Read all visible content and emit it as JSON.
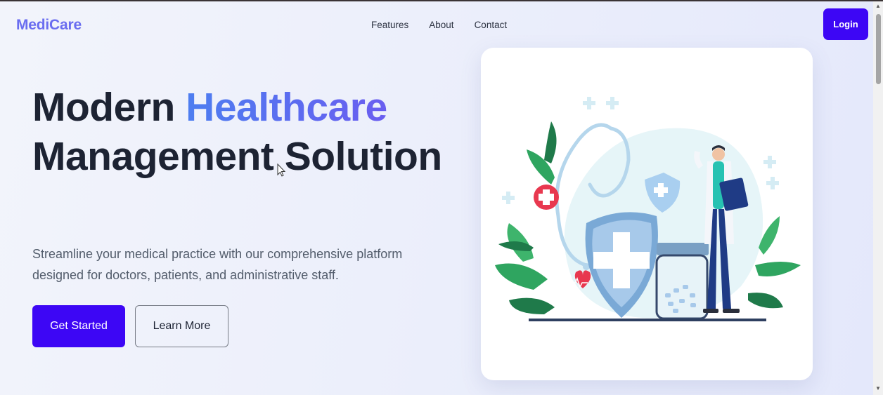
{
  "header": {
    "logo": "MediCare",
    "nav_links": [
      "Features",
      "About",
      "Contact"
    ],
    "login_label": "Login"
  },
  "hero": {
    "title_part1": "Modern ",
    "title_accent": "Healthcare",
    "title_part2": "Management Solution",
    "description": "Streamline your medical practice with our comprehensive platform designed for doctors, patients, and administrative staff.",
    "primary_button": "Get Started",
    "secondary_button": "Learn More",
    "illustration": "doctor-healthcare-illustration"
  },
  "colors": {
    "accent": "#3d06f5",
    "logo": "#6a6df0",
    "gradient_start": "#4d7ef0",
    "gradient_end": "#6a5df0",
    "heading": "#1d2333"
  }
}
